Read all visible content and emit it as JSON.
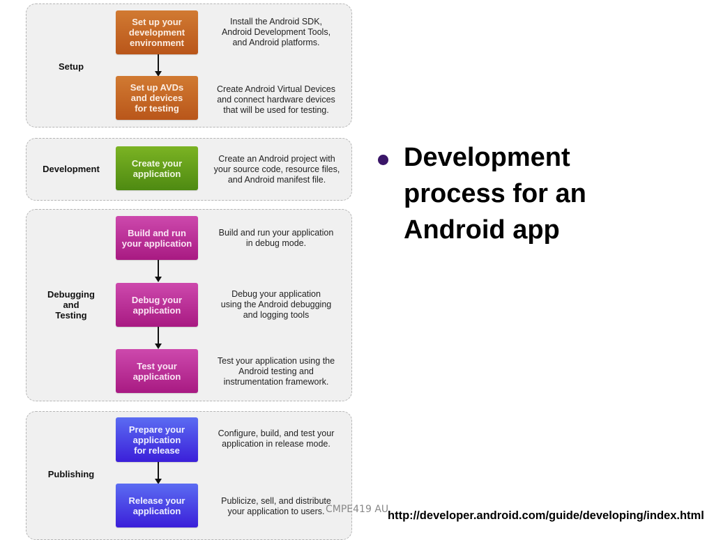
{
  "diagram": {
    "phases": [
      {
        "label": "Setup",
        "color": "#c8681f",
        "steps": [
          {
            "title": "Set up your\ndevelopment\nenvironment",
            "description": "Install the Android SDK,\nAndroid Development Tools,\nand Android platforms."
          },
          {
            "title": "Set up AVDs\nand devices\nfor testing",
            "description": "Create Android Virtual Devices\nand connect hardware devices\nthat will be used for testing."
          }
        ]
      },
      {
        "label": "Development",
        "color": "#64a01a",
        "steps": [
          {
            "title": "Create your\napplication",
            "description": "Create an Android project with\nyour source code, resource files,\nand Android manifest file."
          }
        ]
      },
      {
        "label": "Debugging\nand\nTesting",
        "color": "#bb3298",
        "steps": [
          {
            "title": "Build and run\nyour application",
            "description": "Build and run your application\nin debug mode."
          },
          {
            "title": "Debug your\napplication",
            "description": "Debug your application\nusing the Android debugging\nand logging tools"
          },
          {
            "title": "Test your\napplication",
            "description": "Test your application using the\nAndroid testing and\ninstrumentation framework."
          }
        ]
      },
      {
        "label": "Publishing",
        "color": "#4a45e6",
        "steps": [
          {
            "title": "Prepare your\napplication\nfor release",
            "description": "Configure, build, and test your\napplication in release mode."
          },
          {
            "title": "Release your\napplication",
            "description": "Publicize, sell, and distribute\nyour application to users."
          }
        ]
      }
    ]
  },
  "slide": {
    "bullet": "Development\nprocess for an\nAndroid app",
    "bullet_color": "#3a1668",
    "footer_course": "CMPE419 AU",
    "source_url": "http://developer.android.com/guide/developing/index.html"
  }
}
